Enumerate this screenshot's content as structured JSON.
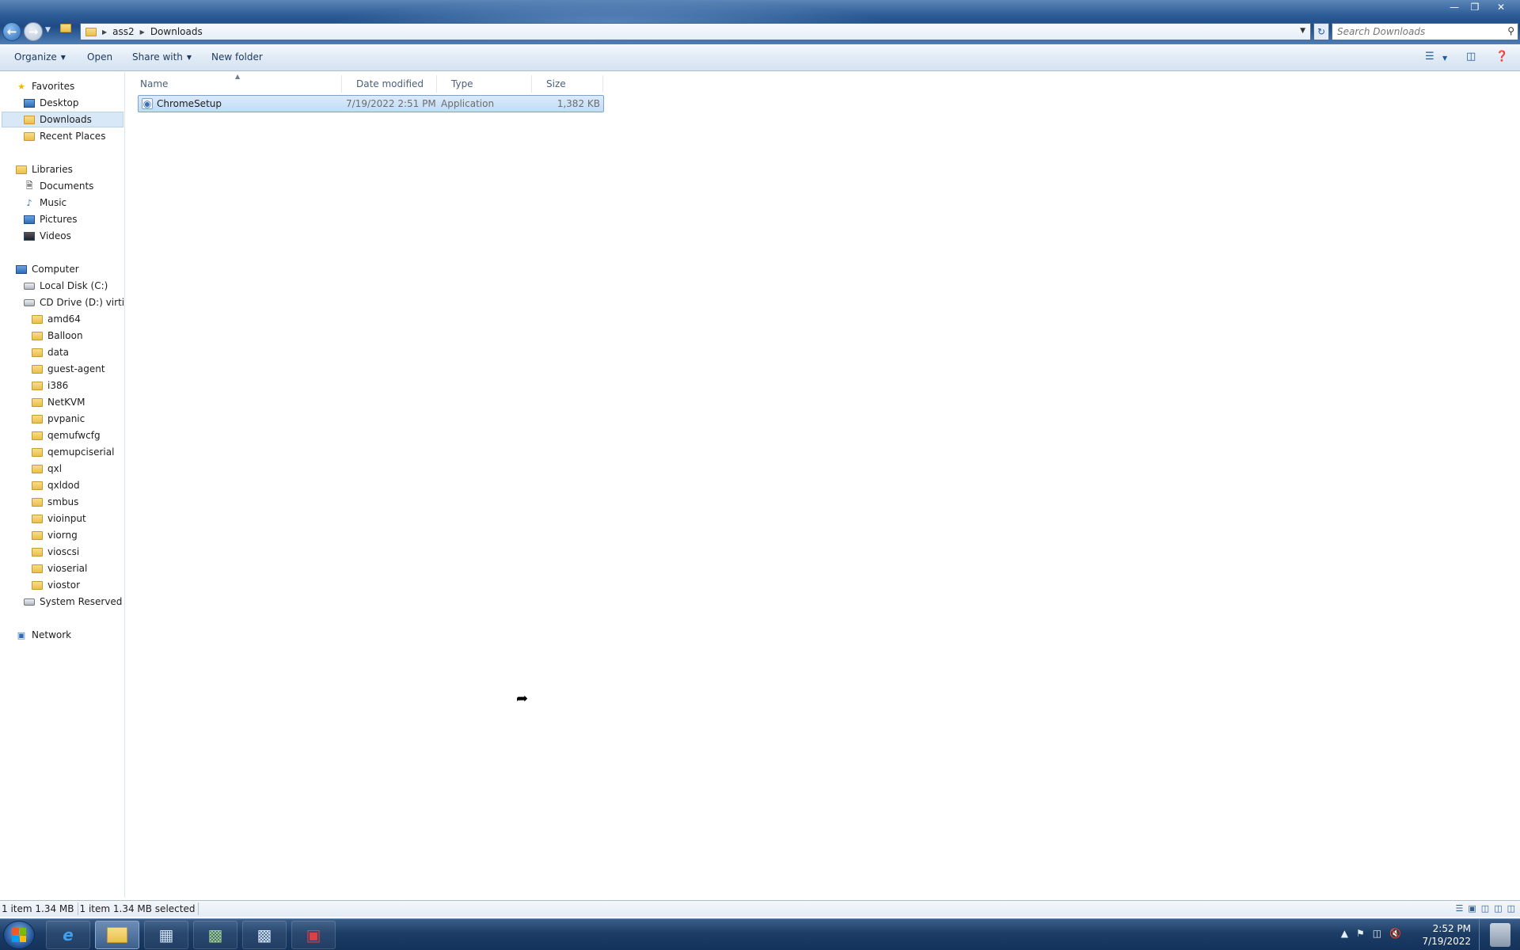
{
  "address_bar": {
    "crumbs": [
      "ass2",
      "Downloads"
    ],
    "search_placeholder": "Search Downloads"
  },
  "toolbar": {
    "organize": "Organize",
    "open": "Open",
    "share_with": "Share with",
    "new_folder": "New folder"
  },
  "nav": {
    "favorites": "Favorites",
    "desktop": "Desktop",
    "downloads": "Downloads",
    "recent_places": "Recent Places",
    "libraries": "Libraries",
    "documents": "Documents",
    "music": "Music",
    "pictures": "Pictures",
    "videos": "Videos",
    "computer": "Computer",
    "local_disk": "Local Disk (C:)",
    "cd_drive": "CD Drive (D:) virtio-v",
    "folders": [
      "amd64",
      "Balloon",
      "data",
      "guest-agent",
      "i386",
      "NetKVM",
      "pvpanic",
      "qemufwcfg",
      "qemupciserial",
      "qxl",
      "qxldod",
      "smbus",
      "vioinput",
      "viorng",
      "vioscsi",
      "vioserial",
      "viostor"
    ],
    "system_reserved": "System Reserved (E:)",
    "network": "Network"
  },
  "columns": {
    "name": "Name",
    "date_modified": "Date modified",
    "type": "Type",
    "size": "Size"
  },
  "files": [
    {
      "name": "ChromeSetup",
      "date_modified": "7/19/2022 2:51 PM",
      "type": "Application",
      "size": "1,382 KB"
    }
  ],
  "status": {
    "items": "1 item 1.34 MB",
    "selected": "1 item 1.34 MB selected"
  },
  "taskbar": {
    "time": "2:52 PM",
    "date": "7/19/2022"
  },
  "colors": {
    "selection": "#c1dcf6",
    "titlebar": "#1f4b85",
    "taskbar": "#14325a"
  }
}
